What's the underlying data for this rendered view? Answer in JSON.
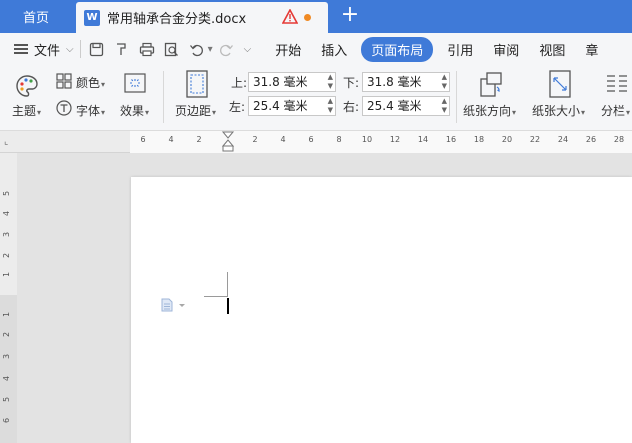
{
  "tabs": {
    "home_label": "首页",
    "doc_icon_letter": "W",
    "doc_title": "常用轴承合金分类.docx",
    "new_tab": "+"
  },
  "menubar": {
    "file_label": "文件",
    "tabs": [
      "开始",
      "插入",
      "页面布局",
      "引用",
      "审阅",
      "视图",
      "章"
    ],
    "active_tab": "页面布局"
  },
  "ribbon": {
    "theme": "主题",
    "color": "颜色",
    "font": "字体",
    "effect": "效果",
    "margins": "页边距",
    "top_label": "上:",
    "top_value": "31.8 毫米",
    "bottom_label": "下:",
    "bottom_value": "31.8 毫米",
    "left_label": "左:",
    "left_value": "25.4 毫米",
    "right_label": "右:",
    "right_value": "25.4 毫米",
    "orientation": "纸张方向",
    "size": "纸张大小",
    "columns": "分栏"
  },
  "rulers": {
    "h_ticks": [
      "6",
      "4",
      "2",
      "2",
      "4",
      "6",
      "8",
      "10",
      "12",
      "14",
      "16",
      "18",
      "20",
      "22",
      "24",
      "26",
      "28"
    ],
    "v_ticks": [
      "5",
      "4",
      "3",
      "2",
      "1",
      "1",
      "2",
      "3",
      "4",
      "5",
      "6"
    ]
  },
  "colors": {
    "accent": "#3f7ad8",
    "warning": "#e53935",
    "modified_dot": "#f08a24"
  }
}
